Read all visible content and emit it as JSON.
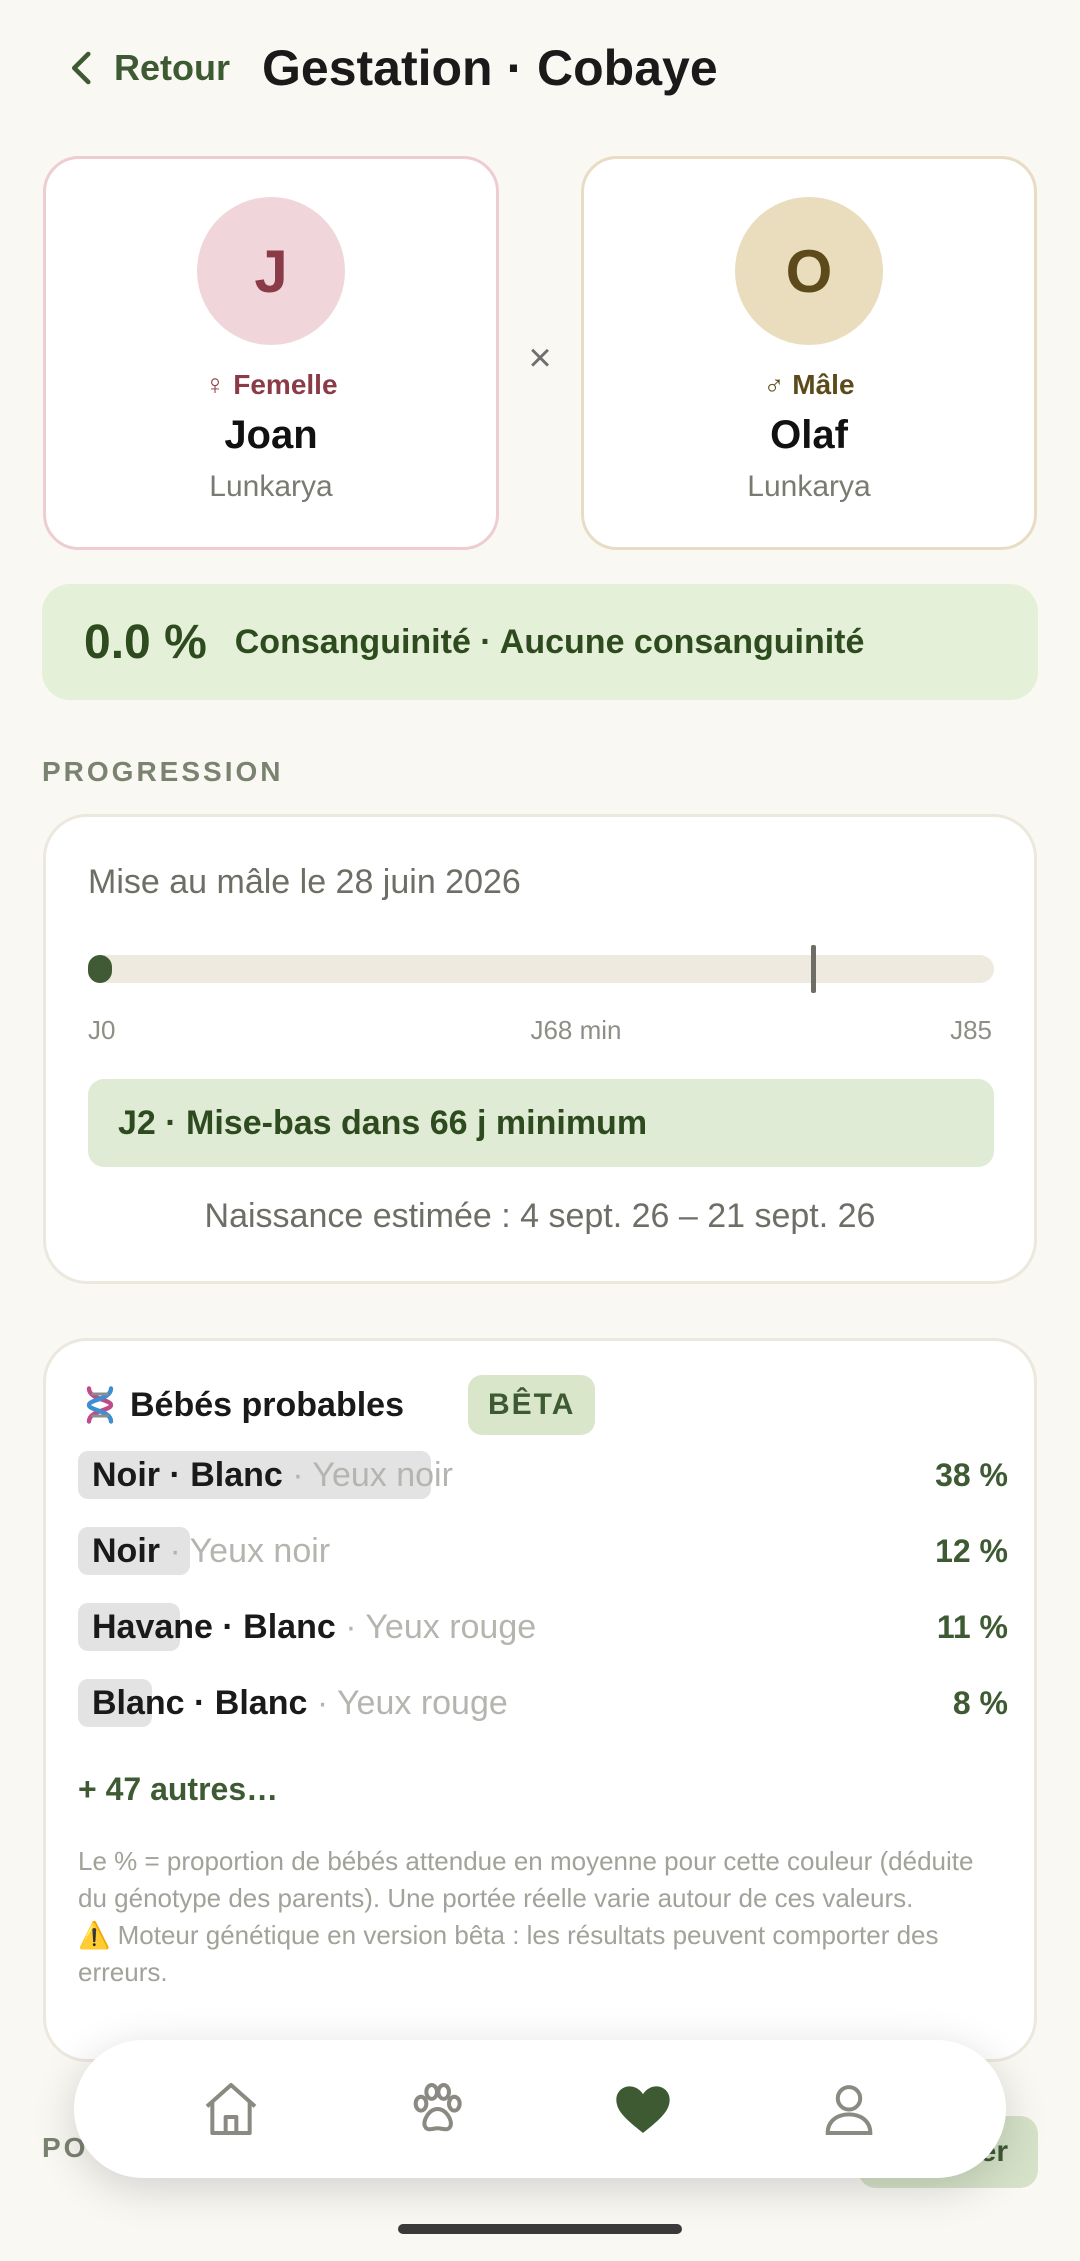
{
  "header": {
    "back_label": "Retour",
    "title": "Gestation · Cobaye"
  },
  "female": {
    "initial": "J",
    "sex_label": "♀ Femelle",
    "name": "Joan",
    "breed": "Lunkarya"
  },
  "cross_symbol": "×",
  "male": {
    "initial": "O",
    "sex_label": "♂ Mâle",
    "name": "Olaf",
    "breed": "Lunkarya"
  },
  "consanguinity": {
    "value": "0.0 %",
    "label": "Consanguinité · Aucune consanguinité"
  },
  "progression": {
    "section_label": "PROGRESSION",
    "mating_text": "Mise au mâle le 28 juin 2026",
    "current_day": 2,
    "total_days": 85,
    "min_day": 68,
    "tick_start": "J0",
    "tick_min": "J68 min",
    "tick_end": "J85",
    "countdown_text": "J2 · Mise-bas dans 66 j minimum",
    "estimate_text": "Naissance estimée : 4 sept. 26 – 21 sept. 26"
  },
  "babies": {
    "title": "Bébés probables",
    "beta_badge": "BÊTA",
    "predictions": [
      {
        "coat": "Noir · Blanc",
        "eyes": " · Yeux noir",
        "percent": "38 %",
        "share": 0.38
      },
      {
        "coat": "Noir",
        "eyes": " · Yeux noir",
        "percent": "12 %",
        "share": 0.12
      },
      {
        "coat": "Havane · Blanc",
        "eyes": " · Yeux rouge",
        "percent": "11 %",
        "share": 0.11
      },
      {
        "coat": "Blanc · Blanc",
        "eyes": " · Yeux rouge",
        "percent": "8 %",
        "share": 0.08
      }
    ],
    "more_label": "+ 47 autres…",
    "note_line1": "Le % = proportion de bébés attendue en moyenne pour cette couleur (déduite du génotype des parents). Une portée réelle varie autour de ces valeurs.",
    "note_line2": "⚠️ Moteur génétique en version bêta : les résultats peuvent comporter des erreurs."
  },
  "below": {
    "section_label_partial": "PO",
    "button_partial": "er"
  },
  "nav": {
    "active": "heart-icon",
    "items": [
      "home-icon",
      "paw-icon",
      "heart-icon",
      "user-icon"
    ]
  },
  "colors": {
    "accent": "#3D5A33",
    "female": "#8B3A47",
    "male": "#5C4A1A",
    "consanguinity_bg": "#E4F0D7"
  }
}
